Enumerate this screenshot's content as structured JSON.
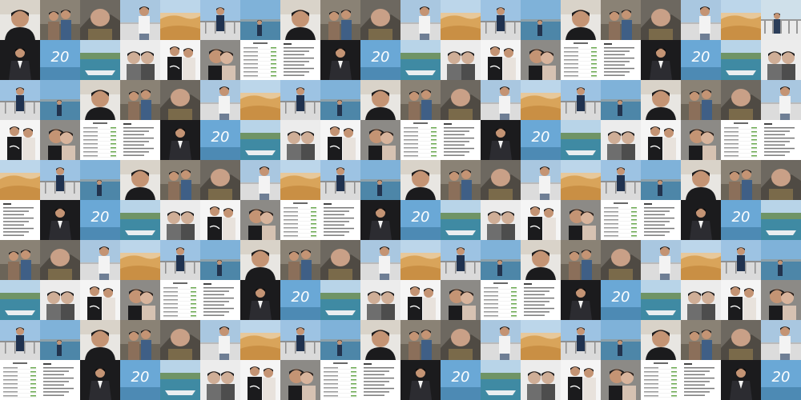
{
  "mosaic": {
    "rows": 10,
    "columns": 20,
    "tile_kinds": {
      "A": "selfie-man-dark-bg",
      "B": "couple-outdoor",
      "C": "rocks-face",
      "D": "man-railing-white-shirt",
      "E": "sand-dunes",
      "F": "man-sea-railing",
      "G": "sea-sky-photographer",
      "H": "man-in-suit",
      "I": "birthday-card-20",
      "J": "boat-lake",
      "K": "two-women-selfie",
      "L": "couple-black-tshirt",
      "M": "couple-closeup",
      "N": "text-document",
      "O": "chat-list-screenshot",
      "P": "man-railing-blue-sky"
    },
    "pattern": [
      "ABCDEPGABCDEPGABCDEF",
      "HIJKLMONHIJKLMONHIJK",
      "PGABCDEPGABCDEPGABCD",
      "LMONHIJKLMONHIJKLMON",
      "EPGABCDEPGABCDEPGABC",
      "NHIJKLMONHIJKLMONHIJ",
      "BCDEPGABCDEPGABCDEPG",
      "JKLMONHIJKLMONHIJKLM",
      "PGABCDEPGABCDEPGABCD",
      "ONHIJKLMONHIJKLMONHI"
    ]
  },
  "colors": {
    "skin": "#c49474",
    "dark": "#1b1b1d",
    "sky": "#7fb2d9",
    "sea": "#4d86a8",
    "sand": "#d9a45a",
    "rock": "#6d6860",
    "white": "#f3f3f3",
    "green": "#6aa84f",
    "paper": "#ffffff",
    "text_gray": "#9a9a9a"
  },
  "card_label": "20"
}
